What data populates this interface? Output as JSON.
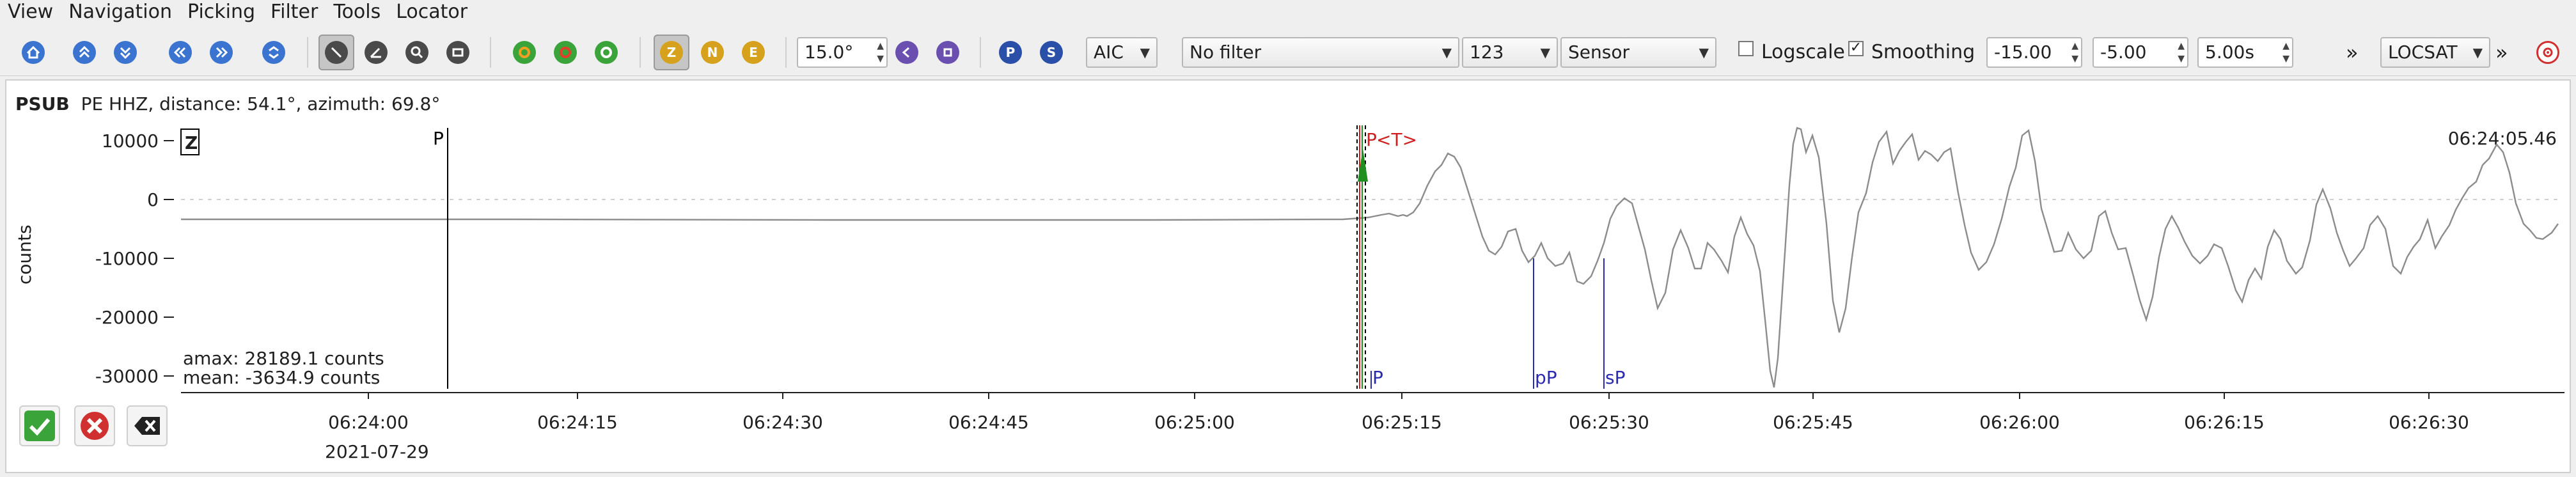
{
  "menu": [
    "View",
    "Navigation",
    "Picking",
    "Filter",
    "Tools",
    "Locator"
  ],
  "toolbar": {
    "angle_value": "15.0°",
    "method_value": "AIC",
    "filter_value": "No filter",
    "channel_value": "123",
    "sensor_value": "Sensor",
    "logscale_label": "Logscale",
    "logscale_checked": false,
    "smoothing_label": "Smoothing",
    "smoothing_checked": true,
    "smoothing_check_mark": "✓",
    "pre_value": "-15.00",
    "post_value": "-5.00",
    "duration_value": "5.00s",
    "more_glyph": "»",
    "locator_value": "LOCSAT",
    "more_glyph_2": "»",
    "icons": [
      "home-icon",
      "up-icon",
      "down-icon",
      "left-icon",
      "right-icon",
      "zoom-icon",
      "pick-tool-icon",
      "angle-tool-icon",
      "magnify-tool-icon",
      "settings-tool-icon",
      "filter-p-icon",
      "filter-s-icon",
      "filter-z-icon",
      "component-z-icon",
      "component-n-icon",
      "component-e-icon",
      "prev-icon",
      "next-icon",
      "phase-p-icon",
      "phase-s-icon",
      "target-icon"
    ],
    "letters": {
      "z": "Z",
      "n": "N",
      "e": "E",
      "p": "P",
      "s": "S"
    },
    "accent_colors": {
      "green": "#3aa33a",
      "orange": "#d98a1e",
      "blue": "#2a4fa8",
      "purple": "#6a4fb0",
      "red": "#d03030",
      "gold": "#d6a21e"
    }
  },
  "trace": {
    "station": "PSUB",
    "info": "PE  HHZ, distance: 54.1°, azimuth: 69.8°",
    "component_badge": "Z",
    "ylabel": "counts",
    "yticks": [
      "10000",
      "0",
      "-10000",
      "-20000",
      "-30000"
    ],
    "time_label_right": "06:24:05.46",
    "xticks": [
      "06:24:00",
      "06:24:15",
      "06:24:30",
      "06:24:45",
      "06:25:00",
      "06:25:15",
      "06:25:30",
      "06:25:45",
      "06:26:00",
      "06:26:15",
      "06:26:30"
    ],
    "date_label": "2021-07-29",
    "amax": "amax: 28189.1 counts",
    "mean": "mean: -3634.9 counts",
    "picks": {
      "p_manual": "P",
      "p_top": "P",
      "t_top": "<T>",
      "p_theo": "P",
      "pp_theo": "pP",
      "sp_theo": "sP"
    },
    "colors": {
      "trace": "#8c8c8c",
      "pick": "#000000",
      "theo": "#2a2ab0",
      "red": "#d02020",
      "green": "#1f8f1f"
    }
  },
  "actions": [
    "accept-icon",
    "reject-icon",
    "clear-icon"
  ]
}
